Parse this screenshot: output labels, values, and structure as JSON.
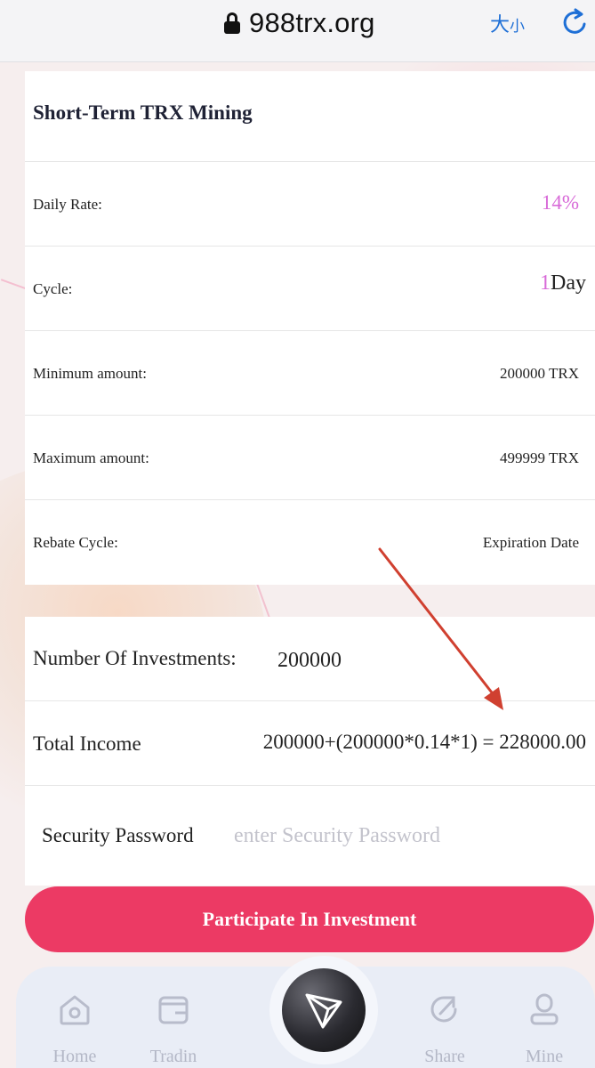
{
  "browser": {
    "url": "988trx.org",
    "text_size_label_big": "大",
    "text_size_label_small": "小"
  },
  "product": {
    "title": "Short-Term TRX Mining",
    "rows": [
      {
        "label": "Daily Rate:",
        "value": "14%"
      },
      {
        "label": "Cycle:",
        "value_num": "1",
        "value_unit": "Day"
      },
      {
        "label": "Minimum amount:",
        "value": "200000 TRX"
      },
      {
        "label": "Maximum amount:",
        "value": "499999 TRX"
      },
      {
        "label": "Rebate Cycle:",
        "value": "Expiration Date"
      }
    ]
  },
  "investment": {
    "number_label": "Number Of Investments:",
    "number_value": "200000",
    "income_label": "Total Income",
    "income_value": "200000+(200000*0.14*1) = 228000.00",
    "password_label": "Security Password",
    "password_placeholder": "enter Security Password",
    "password_value": ""
  },
  "action": {
    "button_label": "Participate In Investment"
  },
  "nav": {
    "items": [
      {
        "label": "Home",
        "icon": "home-icon"
      },
      {
        "label": "Tradin",
        "icon": "wallet-icon"
      },
      {
        "label": "Share",
        "icon": "share-icon"
      },
      {
        "label": "Mine",
        "icon": "user-icon"
      }
    ],
    "center_icon": "tron-logo-icon"
  },
  "colors": {
    "accent": "#ec3a64",
    "highlight": "#d86ad8",
    "link_blue": "#1e6fd6",
    "arrow": "#d04030",
    "nav_inactive": "#b8bccb"
  }
}
